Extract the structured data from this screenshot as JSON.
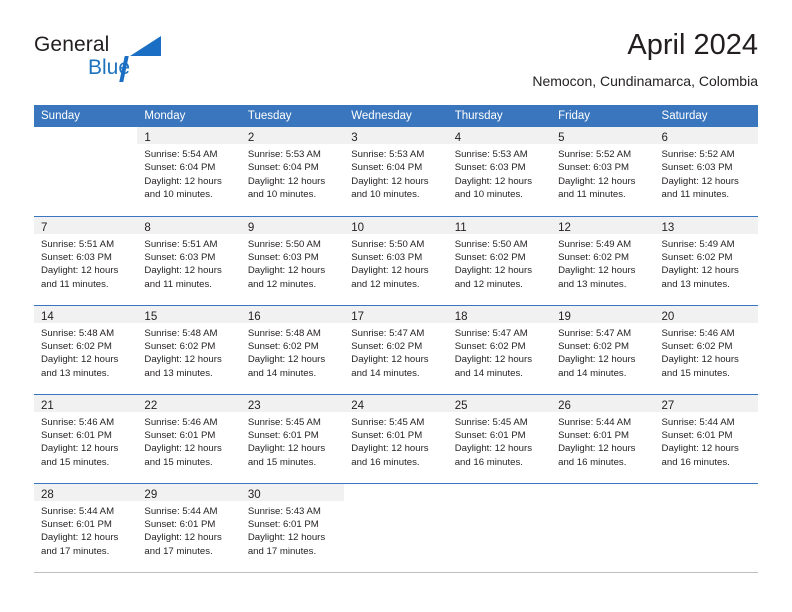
{
  "brand": {
    "logo_general": "General",
    "logo_blue": "Blue",
    "accent_color": "#3a76bd",
    "logo_blue_color": "#1e73be"
  },
  "header": {
    "title": "April 2024",
    "subtitle": "Nemocon, Cundinamarca, Colombia"
  },
  "calendar": {
    "weekday_headers": [
      "Sunday",
      "Monday",
      "Tuesday",
      "Wednesday",
      "Thursday",
      "Friday",
      "Saturday"
    ],
    "weeks": [
      [
        {
          "day": "",
          "sunrise": "",
          "sunset": "",
          "daylight_1": "",
          "daylight_2": ""
        },
        {
          "day": "1",
          "sunrise": "Sunrise: 5:54 AM",
          "sunset": "Sunset: 6:04 PM",
          "daylight_1": "Daylight: 12 hours",
          "daylight_2": "and 10 minutes."
        },
        {
          "day": "2",
          "sunrise": "Sunrise: 5:53 AM",
          "sunset": "Sunset: 6:04 PM",
          "daylight_1": "Daylight: 12 hours",
          "daylight_2": "and 10 minutes."
        },
        {
          "day": "3",
          "sunrise": "Sunrise: 5:53 AM",
          "sunset": "Sunset: 6:04 PM",
          "daylight_1": "Daylight: 12 hours",
          "daylight_2": "and 10 minutes."
        },
        {
          "day": "4",
          "sunrise": "Sunrise: 5:53 AM",
          "sunset": "Sunset: 6:03 PM",
          "daylight_1": "Daylight: 12 hours",
          "daylight_2": "and 10 minutes."
        },
        {
          "day": "5",
          "sunrise": "Sunrise: 5:52 AM",
          "sunset": "Sunset: 6:03 PM",
          "daylight_1": "Daylight: 12 hours",
          "daylight_2": "and 11 minutes."
        },
        {
          "day": "6",
          "sunrise": "Sunrise: 5:52 AM",
          "sunset": "Sunset: 6:03 PM",
          "daylight_1": "Daylight: 12 hours",
          "daylight_2": "and 11 minutes."
        }
      ],
      [
        {
          "day": "7",
          "sunrise": "Sunrise: 5:51 AM",
          "sunset": "Sunset: 6:03 PM",
          "daylight_1": "Daylight: 12 hours",
          "daylight_2": "and 11 minutes."
        },
        {
          "day": "8",
          "sunrise": "Sunrise: 5:51 AM",
          "sunset": "Sunset: 6:03 PM",
          "daylight_1": "Daylight: 12 hours",
          "daylight_2": "and 11 minutes."
        },
        {
          "day": "9",
          "sunrise": "Sunrise: 5:50 AM",
          "sunset": "Sunset: 6:03 PM",
          "daylight_1": "Daylight: 12 hours",
          "daylight_2": "and 12 minutes."
        },
        {
          "day": "10",
          "sunrise": "Sunrise: 5:50 AM",
          "sunset": "Sunset: 6:03 PM",
          "daylight_1": "Daylight: 12 hours",
          "daylight_2": "and 12 minutes."
        },
        {
          "day": "11",
          "sunrise": "Sunrise: 5:50 AM",
          "sunset": "Sunset: 6:02 PM",
          "daylight_1": "Daylight: 12 hours",
          "daylight_2": "and 12 minutes."
        },
        {
          "day": "12",
          "sunrise": "Sunrise: 5:49 AM",
          "sunset": "Sunset: 6:02 PM",
          "daylight_1": "Daylight: 12 hours",
          "daylight_2": "and 13 minutes."
        },
        {
          "day": "13",
          "sunrise": "Sunrise: 5:49 AM",
          "sunset": "Sunset: 6:02 PM",
          "daylight_1": "Daylight: 12 hours",
          "daylight_2": "and 13 minutes."
        }
      ],
      [
        {
          "day": "14",
          "sunrise": "Sunrise: 5:48 AM",
          "sunset": "Sunset: 6:02 PM",
          "daylight_1": "Daylight: 12 hours",
          "daylight_2": "and 13 minutes."
        },
        {
          "day": "15",
          "sunrise": "Sunrise: 5:48 AM",
          "sunset": "Sunset: 6:02 PM",
          "daylight_1": "Daylight: 12 hours",
          "daylight_2": "and 13 minutes."
        },
        {
          "day": "16",
          "sunrise": "Sunrise: 5:48 AM",
          "sunset": "Sunset: 6:02 PM",
          "daylight_1": "Daylight: 12 hours",
          "daylight_2": "and 14 minutes."
        },
        {
          "day": "17",
          "sunrise": "Sunrise: 5:47 AM",
          "sunset": "Sunset: 6:02 PM",
          "daylight_1": "Daylight: 12 hours",
          "daylight_2": "and 14 minutes."
        },
        {
          "day": "18",
          "sunrise": "Sunrise: 5:47 AM",
          "sunset": "Sunset: 6:02 PM",
          "daylight_1": "Daylight: 12 hours",
          "daylight_2": "and 14 minutes."
        },
        {
          "day": "19",
          "sunrise": "Sunrise: 5:47 AM",
          "sunset": "Sunset: 6:02 PM",
          "daylight_1": "Daylight: 12 hours",
          "daylight_2": "and 14 minutes."
        },
        {
          "day": "20",
          "sunrise": "Sunrise: 5:46 AM",
          "sunset": "Sunset: 6:02 PM",
          "daylight_1": "Daylight: 12 hours",
          "daylight_2": "and 15 minutes."
        }
      ],
      [
        {
          "day": "21",
          "sunrise": "Sunrise: 5:46 AM",
          "sunset": "Sunset: 6:01 PM",
          "daylight_1": "Daylight: 12 hours",
          "daylight_2": "and 15 minutes."
        },
        {
          "day": "22",
          "sunrise": "Sunrise: 5:46 AM",
          "sunset": "Sunset: 6:01 PM",
          "daylight_1": "Daylight: 12 hours",
          "daylight_2": "and 15 minutes."
        },
        {
          "day": "23",
          "sunrise": "Sunrise: 5:45 AM",
          "sunset": "Sunset: 6:01 PM",
          "daylight_1": "Daylight: 12 hours",
          "daylight_2": "and 15 minutes."
        },
        {
          "day": "24",
          "sunrise": "Sunrise: 5:45 AM",
          "sunset": "Sunset: 6:01 PM",
          "daylight_1": "Daylight: 12 hours",
          "daylight_2": "and 16 minutes."
        },
        {
          "day": "25",
          "sunrise": "Sunrise: 5:45 AM",
          "sunset": "Sunset: 6:01 PM",
          "daylight_1": "Daylight: 12 hours",
          "daylight_2": "and 16 minutes."
        },
        {
          "day": "26",
          "sunrise": "Sunrise: 5:44 AM",
          "sunset": "Sunset: 6:01 PM",
          "daylight_1": "Daylight: 12 hours",
          "daylight_2": "and 16 minutes."
        },
        {
          "day": "27",
          "sunrise": "Sunrise: 5:44 AM",
          "sunset": "Sunset: 6:01 PM",
          "daylight_1": "Daylight: 12 hours",
          "daylight_2": "and 16 minutes."
        }
      ],
      [
        {
          "day": "28",
          "sunrise": "Sunrise: 5:44 AM",
          "sunset": "Sunset: 6:01 PM",
          "daylight_1": "Daylight: 12 hours",
          "daylight_2": "and 17 minutes."
        },
        {
          "day": "29",
          "sunrise": "Sunrise: 5:44 AM",
          "sunset": "Sunset: 6:01 PM",
          "daylight_1": "Daylight: 12 hours",
          "daylight_2": "and 17 minutes."
        },
        {
          "day": "30",
          "sunrise": "Sunrise: 5:43 AM",
          "sunset": "Sunset: 6:01 PM",
          "daylight_1": "Daylight: 12 hours",
          "daylight_2": "and 17 minutes."
        },
        {
          "day": "",
          "sunrise": "",
          "sunset": "",
          "daylight_1": "",
          "daylight_2": ""
        },
        {
          "day": "",
          "sunrise": "",
          "sunset": "",
          "daylight_1": "",
          "daylight_2": ""
        },
        {
          "day": "",
          "sunrise": "",
          "sunset": "",
          "daylight_1": "",
          "daylight_2": ""
        },
        {
          "day": "",
          "sunrise": "",
          "sunset": "",
          "daylight_1": "",
          "daylight_2": ""
        }
      ]
    ]
  }
}
